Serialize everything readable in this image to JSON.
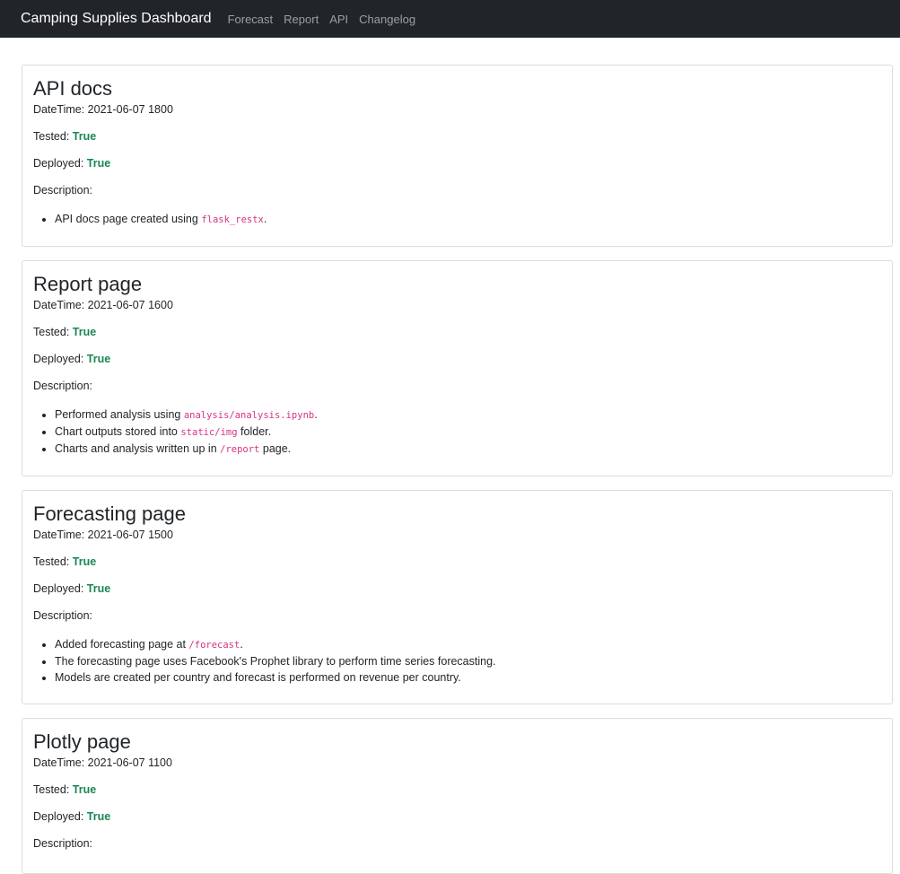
{
  "nav": {
    "brand": "Camping Supplies Dashboard",
    "links": [
      "Forecast",
      "Report",
      "API",
      "Changelog"
    ]
  },
  "labels": {
    "datetime": "DateTime: ",
    "tested": "Tested: ",
    "deployed": "Deployed: ",
    "description": "Description:"
  },
  "entries": [
    {
      "title": "API docs",
      "datetime": "2021-06-07 1800",
      "tested": "True",
      "deployed": "True",
      "items": [
        {
          "parts": [
            {
              "t": "API docs page created using "
            },
            {
              "code": "flask_restx"
            },
            {
              "t": "."
            }
          ]
        }
      ]
    },
    {
      "title": "Report page",
      "datetime": "2021-06-07 1600",
      "tested": "True",
      "deployed": "True",
      "items": [
        {
          "parts": [
            {
              "t": "Performed analysis using "
            },
            {
              "code": "analysis/analysis.ipynb"
            },
            {
              "t": "."
            }
          ]
        },
        {
          "parts": [
            {
              "t": "Chart outputs stored into "
            },
            {
              "code": "static/img"
            },
            {
              "t": " folder."
            }
          ]
        },
        {
          "parts": [
            {
              "t": "Charts and analysis written up in "
            },
            {
              "code": "/report"
            },
            {
              "t": " page."
            }
          ]
        }
      ]
    },
    {
      "title": "Forecasting page",
      "datetime": "2021-06-07 1500",
      "tested": "True",
      "deployed": "True",
      "items": [
        {
          "parts": [
            {
              "t": "Added forecasting page at "
            },
            {
              "code": "/forecast"
            },
            {
              "t": "."
            }
          ]
        },
        {
          "parts": [
            {
              "t": "The forecasting page uses Facebook's Prophet library to perform time series forecasting."
            }
          ]
        },
        {
          "parts": [
            {
              "t": "Models are created per country and forecast is performed on revenue per country."
            }
          ]
        }
      ]
    },
    {
      "title": "Plotly page",
      "datetime": "2021-06-07 1100",
      "tested": "True",
      "deployed": "True",
      "items": []
    }
  ]
}
